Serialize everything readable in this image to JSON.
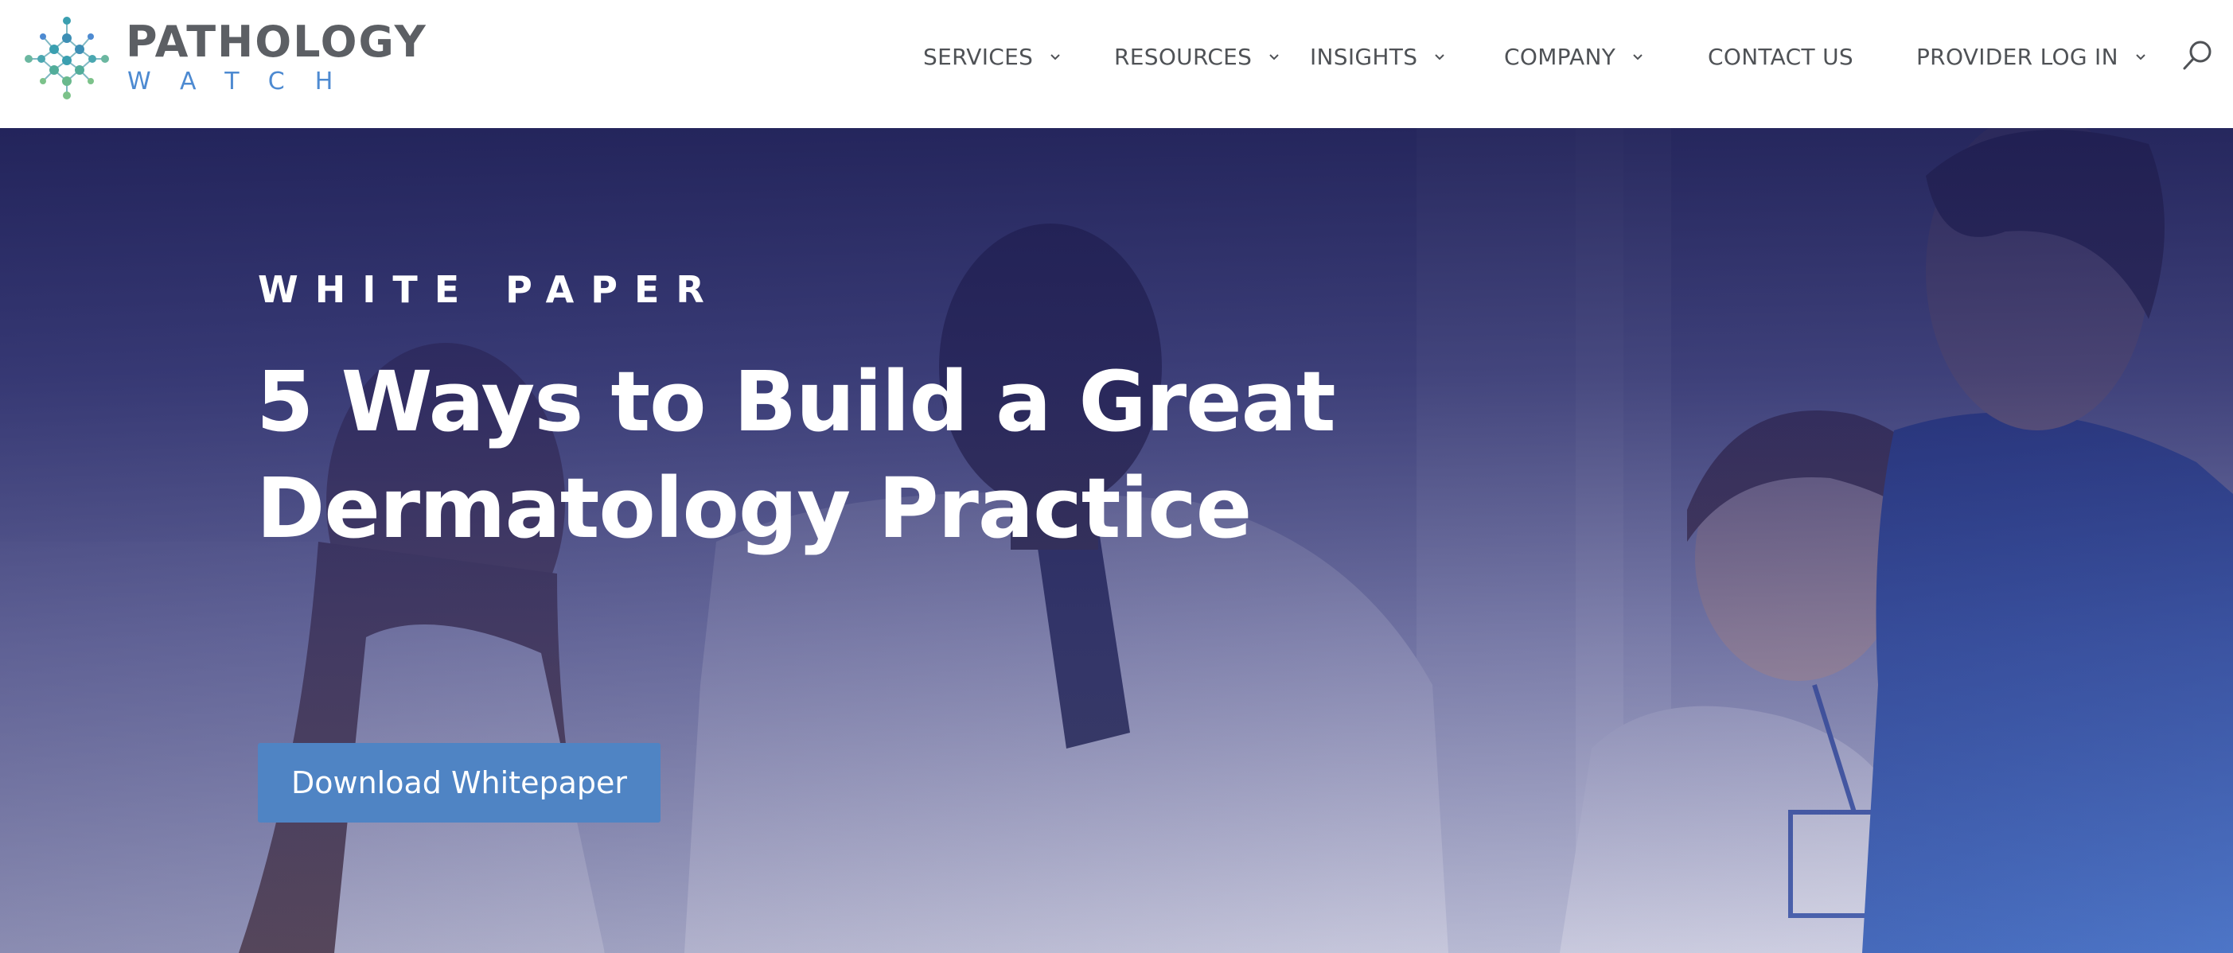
{
  "brand": {
    "name_line1": "PATHOLOGY",
    "name_line2": "WATCH",
    "logo_icon": "molecule-network-icon",
    "colors": {
      "wordmark": "#5c5f64",
      "wordmark_secondary": "#4d8ad1",
      "icon_teal": "#3a9fb0",
      "icon_green": "#69b98d"
    }
  },
  "nav": {
    "items": [
      {
        "label": "SERVICES",
        "has_dropdown": true
      },
      {
        "label": "RESOURCES",
        "has_dropdown": true
      },
      {
        "label": "INSIGHTS",
        "has_dropdown": true
      },
      {
        "label": "COMPANY",
        "has_dropdown": true
      },
      {
        "label": "CONTACT US",
        "has_dropdown": false
      },
      {
        "label": "PROVIDER LOG IN",
        "has_dropdown": true
      }
    ],
    "search_icon": "search-icon",
    "text_color": "#4f5256"
  },
  "hero": {
    "eyebrow": "WHITE PAPER",
    "title_line1": "5 Ways to Build a Great",
    "title_line2": "Dermatology Practice",
    "cta_label": "Download Whitepaper",
    "colors": {
      "overlay": "#1d1e56",
      "cta_background": "#4f84c4",
      "text": "#ffffff"
    }
  }
}
